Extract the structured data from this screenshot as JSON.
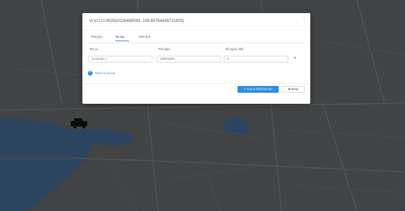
{
  "modal": {
    "title": "Vị trí (10.952610226468593, 106.80764436721803)",
    "close_label": "×"
  },
  "tabs": [
    {
      "label": "Thông tin"
    },
    {
      "label": "Tai nạn"
    },
    {
      "label": "Hình ảnh"
    }
  ],
  "form": {
    "columns": [
      "Tên vụ",
      "Thời gian",
      "Số người chết"
    ],
    "row": {
      "name": "Vụ tai nạn 1",
      "time": "15/07/2020",
      "deaths": "0"
    },
    "delete_icon": "×",
    "add_link": "Thêm vụ tai nạn",
    "add_icon": "+"
  },
  "footer": {
    "save_label": "✔ Lưu & Thêm tai nạn",
    "close_label": "✖ Đóng"
  },
  "colors": {
    "accent": "#2f8fe0",
    "danger": "#e04a4a",
    "map_land": "#5b5e5f",
    "map_water": "#3f5f86"
  }
}
